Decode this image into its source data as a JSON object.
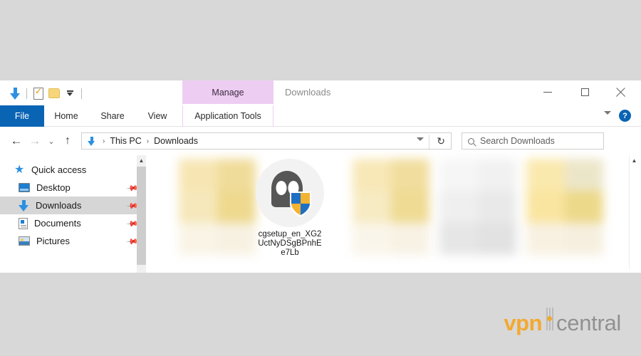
{
  "window": {
    "title": "Downloads",
    "controls": {
      "minimize": "minimize-button",
      "maximize": "maximize-button",
      "close": "close-button"
    }
  },
  "quick_access_toolbar": {
    "items": [
      {
        "icon": "downloads-arrow-icon",
        "label": "Downloads"
      },
      {
        "icon": "properties-icon",
        "label": "Properties"
      },
      {
        "icon": "new-folder-icon",
        "label": "New folder"
      },
      {
        "icon": "customize-chevron-icon",
        "label": "Customize Quick Access Toolbar"
      }
    ]
  },
  "ribbon": {
    "contextual_tab_group": "Manage",
    "tabs": [
      {
        "label": "File",
        "active": true
      },
      {
        "label": "Home",
        "active": false
      },
      {
        "label": "Share",
        "active": false
      },
      {
        "label": "View",
        "active": false
      },
      {
        "label": "Application Tools",
        "active": false
      }
    ],
    "expand_icon": "chevron-down-icon",
    "help_label": "?"
  },
  "navigation": {
    "back": "◄",
    "forward": "►",
    "recent": "⌄",
    "up": "↑",
    "path_icon": "downloads-arrow-icon",
    "breadcrumbs": [
      "This PC",
      "Downloads"
    ],
    "separator": "›",
    "dropdown_icon": "chevron-down-icon",
    "refresh_icon": "refresh-icon"
  },
  "search": {
    "icon": "search-icon",
    "placeholder": "Search Downloads",
    "value": ""
  },
  "sidebar": {
    "items": [
      {
        "label": "Quick access",
        "icon": "pin-star-icon",
        "selected": false,
        "pinned": false
      },
      {
        "label": "Desktop",
        "icon": "desktop-icon",
        "selected": false,
        "pinned": true
      },
      {
        "label": "Downloads",
        "icon": "downloads-arrow-icon",
        "selected": true,
        "pinned": true
      },
      {
        "label": "Documents",
        "icon": "documents-icon",
        "selected": false,
        "pinned": true
      },
      {
        "label": "Pictures",
        "icon": "pictures-icon",
        "selected": false,
        "pinned": true
      }
    ],
    "pin_icon": "pin-icon",
    "scroll_up_icon": "chevron-up-icon"
  },
  "file_grid": {
    "scroll_up_icon": "chevron-up-icon",
    "items": [
      {
        "name": "",
        "blurred": true,
        "icon": "blurred-thumbnail",
        "colors": [
          "#f7e6b4",
          "#f0dc9a",
          "#f3ecd9",
          "#f7f2e4",
          "#faf6ec",
          "#f8f4e8"
        ]
      },
      {
        "name": "cgsetup_en_XG2UctNyDSgBPnhEe7Lb",
        "blurred": false,
        "icon": "cyberghost-setup-icon",
        "display_lines": [
          "cgsetup_en_XG2",
          "UctNyDSgBPnhE",
          "e7Lb"
        ]
      },
      {
        "name": "",
        "blurred": true,
        "icon": "blurred-thumbnail",
        "colors": [
          "#f7e6b4",
          "#f0dc9a",
          "#f3ecd9",
          "#f7f2e4",
          "#faf6ec",
          "#f8f4e8"
        ]
      },
      {
        "name": "",
        "blurred": true,
        "icon": "blurred-thumbnail",
        "colors": [
          "#f4f4f4",
          "#efefef",
          "#e7e7e7",
          "#e4e4e4",
          "#f1f1f1",
          "#ededed"
        ]
      },
      {
        "name": "",
        "blurred": true,
        "icon": "blurred-thumbnail",
        "colors": [
          "#fae9ad",
          "#ece6c9",
          "#fae5a0",
          "#edd98a",
          "#f7f0e0",
          "#f6efdf"
        ]
      }
    ]
  },
  "file_icon": {
    "name": "cyberghost-setup-icon",
    "ghost_color": "#565656",
    "shield_blue": "#1f6fc4",
    "shield_yellow": "#f2b233",
    "circle_bg": "#f2f2f2"
  },
  "watermark": {
    "brand_first": "vpn",
    "brand_second": "central",
    "brand_color": "#f5a623",
    "second_color": "#8c8c8c"
  },
  "colors": {
    "desktop_background": "#d8d8d8",
    "window_background": "#ffffff",
    "file_tab_blue": "#0a64b4",
    "contextual_purple": "#eecdf3",
    "selection_gray": "#d6d6d6",
    "accent_blue": "#2c90e2"
  }
}
